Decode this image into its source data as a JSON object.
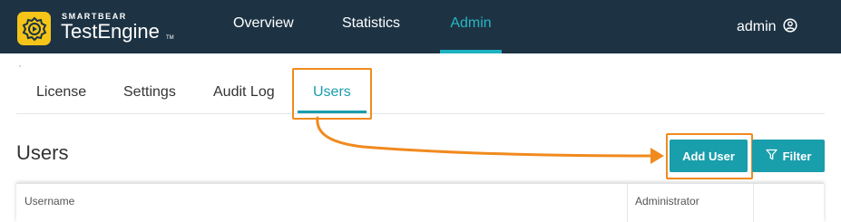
{
  "header": {
    "brand_small": "SMARTBEAR",
    "brand_name": "TestEngine",
    "brand_tm": "TM",
    "nav": [
      "Overview",
      "Statistics",
      "Admin"
    ],
    "active_nav": "Admin",
    "user": "admin",
    "user_icon": "user-circle-icon"
  },
  "tabs": {
    "items": [
      "License",
      "Settings",
      "Audit Log",
      "Users"
    ],
    "active": "Users"
  },
  "main": {
    "title": "Users",
    "add_user_label": "Add User",
    "filter_label": "Filter",
    "filter_icon": "filter-funnel-icon"
  },
  "table": {
    "columns": [
      "Username",
      "Administrator"
    ]
  },
  "colors": {
    "topbar": "#1d3344",
    "accent": "#199eac",
    "logo": "#f4c518",
    "annotation": "#f08a1e"
  }
}
